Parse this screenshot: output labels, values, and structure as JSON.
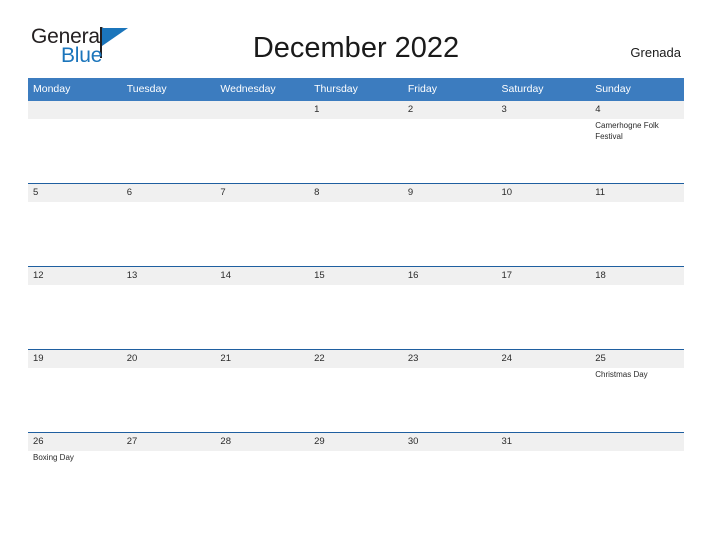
{
  "brand": {
    "name_part1": "General",
    "name_part2": "Blue",
    "flag_icon": "flag-icon",
    "accent_color": "#1b75bb"
  },
  "header": {
    "title": "December 2022",
    "region": "Grenada"
  },
  "theme": {
    "header_blue": "#3c7cbf",
    "rule_blue": "#1f5fa0",
    "date_band": "#f0f0f0",
    "text": "#2b2b2b"
  },
  "calendar": {
    "day_headers": [
      "Monday",
      "Tuesday",
      "Wednesday",
      "Thursday",
      "Friday",
      "Saturday",
      "Sunday"
    ],
    "weeks": [
      {
        "dates": [
          "",
          "",
          "",
          "1",
          "2",
          "3",
          "4"
        ],
        "events": [
          "",
          "",
          "",
          "",
          "",
          "",
          "Camerhogne Folk Festival"
        ]
      },
      {
        "dates": [
          "5",
          "6",
          "7",
          "8",
          "9",
          "10",
          "11"
        ],
        "events": [
          "",
          "",
          "",
          "",
          "",
          "",
          ""
        ]
      },
      {
        "dates": [
          "12",
          "13",
          "14",
          "15",
          "16",
          "17",
          "18"
        ],
        "events": [
          "",
          "",
          "",
          "",
          "",
          "",
          ""
        ]
      },
      {
        "dates": [
          "19",
          "20",
          "21",
          "22",
          "23",
          "24",
          "25"
        ],
        "events": [
          "",
          "",
          "",
          "",
          "",
          "",
          "Christmas Day"
        ]
      },
      {
        "dates": [
          "26",
          "27",
          "28",
          "29",
          "30",
          "31",
          ""
        ],
        "events": [
          "Boxing Day",
          "",
          "",
          "",
          "",
          "",
          ""
        ]
      }
    ]
  }
}
